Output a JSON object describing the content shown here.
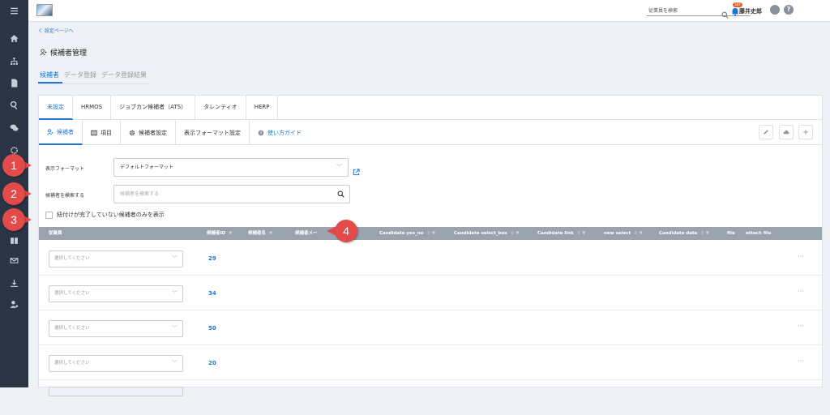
{
  "topbar": {
    "search_placeholder": "従業員を検索",
    "notification_count": "187",
    "username": "藤井史郎"
  },
  "back_link": "く 設定ページへ",
  "page_title": "候補者管理",
  "top_tabs": [
    "候補者",
    "データ登録",
    "データ登録結果"
  ],
  "source_tabs": [
    "未設定",
    "HRMOS",
    "ジョブカン候補者（ATS）",
    "タレンティオ",
    "HERP"
  ],
  "sub_tabs": {
    "candidates": "候補者",
    "items": "項目",
    "candidate_settings": "候補者設定",
    "display_format_settings": "表示フォーマット設定",
    "guide": "使い方ガイド"
  },
  "form": {
    "format_label": "表示フォーマット",
    "format_value": "デフォルトフォーマット",
    "search_label": "候補者を検索する",
    "search_placeholder": "候補者を検索する",
    "checkbox_label": "紐付けが完了していない候補者のみを表示"
  },
  "table": {
    "columns": [
      "従業員",
      "候補者ID",
      "候補者名",
      "候補者メー",
      "Candidate yes_no",
      "Candidate select_box",
      "Candidate link",
      "new select",
      "Candidate date",
      "file",
      "attach file"
    ],
    "rows": [
      {
        "employee": "選択してください",
        "id": "29"
      },
      {
        "employee": "選択してください",
        "id": "34"
      },
      {
        "employee": "選択してください",
        "id": "50"
      },
      {
        "employee": "選択してください",
        "id": "20"
      }
    ],
    "more": "···"
  },
  "callouts": [
    "1",
    "2",
    "3",
    "4"
  ],
  "colors": {
    "accent": "#1f75d4",
    "sidebar": "#2b3445",
    "callout": "#e34b4b",
    "table_header": "#9ba3ae"
  }
}
